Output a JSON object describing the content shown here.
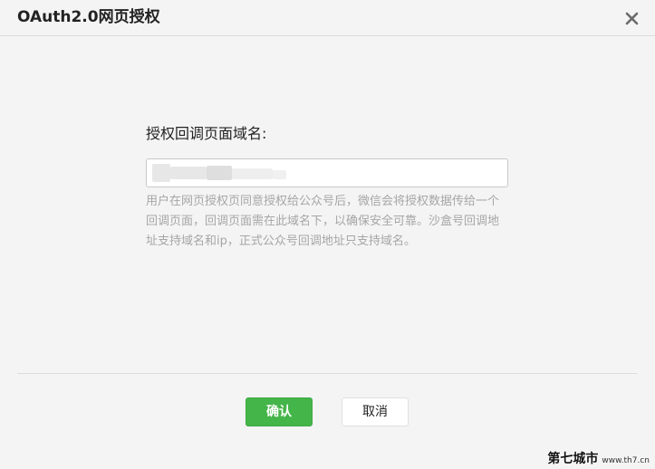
{
  "dialog": {
    "title": "OAuth2.0网页授权",
    "close_icon": "close-icon"
  },
  "form": {
    "label": "授权回调页面域名:",
    "input_value": "",
    "input_placeholder": "",
    "help_text": "用户在网页授权页同意授权给公众号后，微信会将授权数据传给一个回调页面，回调页面需在此域名下，以确保安全可靠。沙盒号回调地址支持域名和ip，正式公众号回调地址只支持域名。"
  },
  "buttons": {
    "confirm_label": "确认",
    "cancel_label": "取消"
  },
  "watermark": {
    "site_name": "第七城市",
    "site_url": "www.th7.cn"
  },
  "colors": {
    "primary": "#44b549",
    "background": "#f4f4f4",
    "help_text": "#a6a6a6"
  }
}
